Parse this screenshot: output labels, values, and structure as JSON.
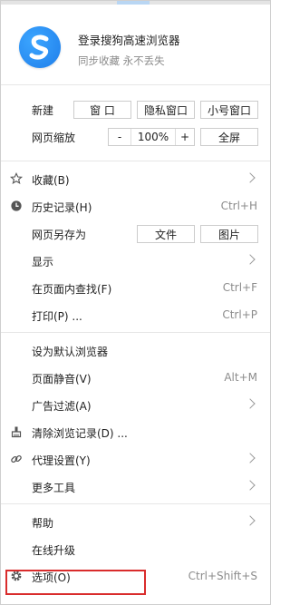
{
  "login": {
    "title": "登录搜狗高速浏览器",
    "subtitle": "同步收藏 永不丢失"
  },
  "new": {
    "label": "新建",
    "window": "窗 口",
    "private": "隐私窗口",
    "small": "小号窗口"
  },
  "zoom": {
    "label": "网页缩放",
    "minus": "-",
    "value": "100%",
    "plus": "+",
    "fullscreen": "全屏"
  },
  "menu": {
    "favorites": "收藏(B)",
    "history": "历史记录(H)",
    "history_shortcut": "Ctrl+H",
    "save_as": "网页另存为",
    "save_file": "文件",
    "save_image": "图片",
    "display": "显示",
    "find": "在页面内查找(F)",
    "find_shortcut": "Ctrl+F",
    "print": "打印(P) ...",
    "print_shortcut": "Ctrl+P",
    "default_browser": "设为默认浏览器",
    "mute": "页面静音(V)",
    "mute_shortcut": "Alt+M",
    "ad_filter": "广告过滤(A)",
    "clear_history": "清除浏览记录(D) ...",
    "proxy": "代理设置(Y)",
    "more_tools": "更多工具",
    "help": "帮助",
    "upgrade": "在线升级",
    "options": "选项(O)",
    "options_shortcut": "Ctrl+Shift+S"
  },
  "colors": {
    "accent": "#1f7eea",
    "highlight": "#d92c2c"
  }
}
